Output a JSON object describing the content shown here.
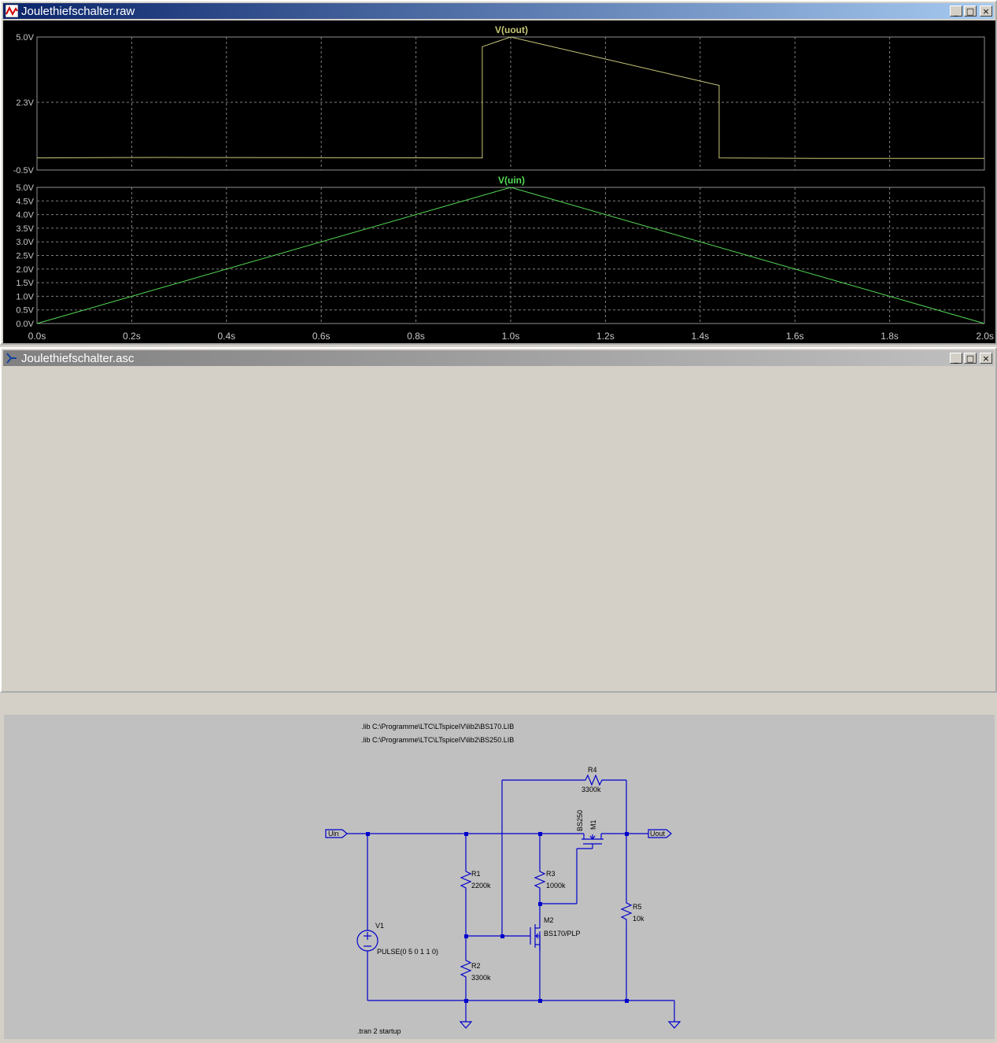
{
  "raw_window": {
    "title": "Joulethiefschalter.raw",
    "buttons": {
      "minimize": "_",
      "maximize": "□",
      "close": "×"
    }
  },
  "schematic_window": {
    "title": "Joulethiefschalter.asc",
    "buttons": {
      "minimize": "_",
      "maximize": "□",
      "close": "×"
    },
    "directives": {
      "lib1": ".lib C:\\Programme\\LTC\\LTspiceIV\\lib2\\BS170.LIB",
      "lib2": ".lib C:\\Programme\\LTC\\LTspiceIV\\lib2\\BS250.LIB",
      "tran": ".tran 2 startup"
    },
    "labels": {
      "uin": "Uin",
      "uout": "Uout",
      "v1_name": "V1",
      "v1_value": "PULSE(0 5 0 1 1 0)",
      "r1_name": "R1",
      "r1_value": "2200k",
      "r2_name": "R2",
      "r2_value": "3300k",
      "r3_name": "R3",
      "r3_value": "1000k",
      "r4_name": "R4",
      "r4_value": "3300k",
      "r5_name": "R5",
      "r5_value": "10k",
      "m1_name": "M1",
      "m1_model": "BS250",
      "m2_name": "M2",
      "m2_model": "BS170/PLP"
    }
  },
  "chart_data": [
    {
      "type": "line",
      "title": "V(uout)",
      "color": "#c8c878",
      "grid": true,
      "xlim": [
        0,
        2.0
      ],
      "ylim": [
        -0.5,
        5.0
      ],
      "yticks": [
        "5.0V",
        "2.3V",
        "-0.5V"
      ],
      "ytick_values": [
        5.0,
        2.3,
        -0.5
      ],
      "series": [
        {
          "name": "V(uout)",
          "x": [
            0,
            0.27,
            0.94,
            0.94,
            1.0,
            1.44,
            1.44,
            1.66,
            2.0
          ],
          "y": [
            0.0,
            0.02,
            0.0,
            4.6,
            5.0,
            3.0,
            0.0,
            -0.02,
            -0.02
          ]
        }
      ]
    },
    {
      "type": "line",
      "title": "V(uin)",
      "color": "#55dd55",
      "grid": true,
      "xlim": [
        0,
        2.0
      ],
      "ylim": [
        0,
        5.0
      ],
      "yticks": [
        "5.0V",
        "4.5V",
        "4.0V",
        "3.5V",
        "3.0V",
        "2.5V",
        "2.0V",
        "1.5V",
        "1.0V",
        "0.5V",
        "0.0V"
      ],
      "ytick_values": [
        5.0,
        4.5,
        4.0,
        3.5,
        3.0,
        2.5,
        2.0,
        1.5,
        1.0,
        0.5,
        0.0
      ],
      "xticks": [
        "0.0s",
        "0.2s",
        "0.4s",
        "0.6s",
        "0.8s",
        "1.0s",
        "1.2s",
        "1.4s",
        "1.6s",
        "1.8s",
        "2.0s"
      ],
      "xtick_values": [
        0,
        0.2,
        0.4,
        0.6,
        0.8,
        1.0,
        1.2,
        1.4,
        1.6,
        1.8,
        2.0
      ],
      "series": [
        {
          "name": "V(uin)",
          "x": [
            0,
            1.0,
            2.0
          ],
          "y": [
            0,
            5.0,
            0
          ]
        }
      ]
    }
  ]
}
